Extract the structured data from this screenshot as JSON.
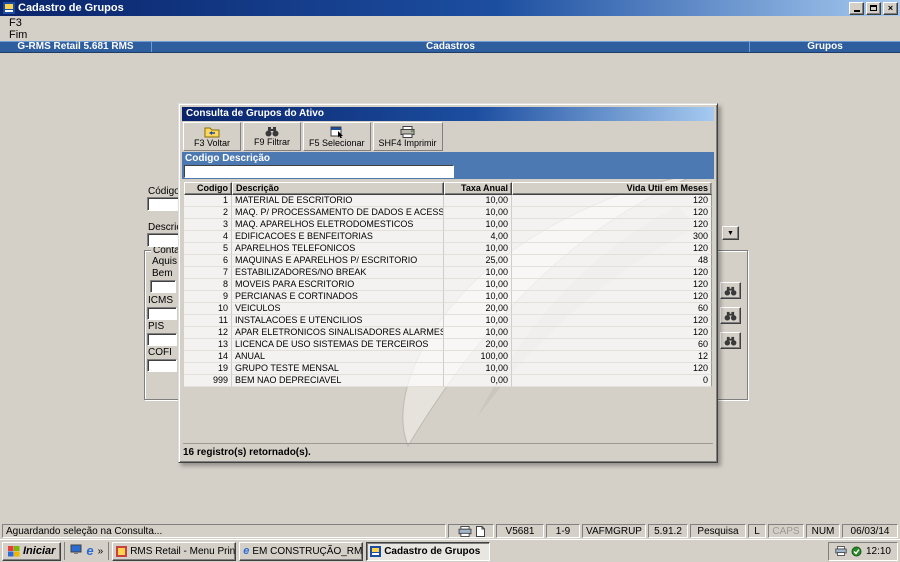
{
  "window": {
    "title": "Cadastro de Grupos",
    "menu_item": "F3",
    "menu_subitem": "Fim",
    "header_left": "G-RMS Retail 5.681 RMS",
    "header_center": "Cadastros",
    "header_right": "Grupos"
  },
  "form": {
    "codigo": "Código",
    "descricao": "Descriç",
    "contab": "Contab",
    "aquis": "Aquis",
    "bem": "Bem",
    "icms": "ICMS",
    "pis": "PIS",
    "cofins": "COFI"
  },
  "dialog": {
    "title": "Consulta de Grupos do Ativo",
    "toolbar_labels": [
      "F3 Voltar",
      "F9 Filtrar",
      "F5 Selecionar",
      "SHF4 Imprimir"
    ],
    "filter_label": "Codigo Descrição",
    "filter_value": "",
    "table": {
      "columns": [
        "Codigo",
        "Descrição",
        "Taxa Anual",
        "Vida Util em Meses"
      ],
      "rows": [
        [
          "1",
          "MATERIAL DE ESCRITORIO",
          "10,00",
          "120"
        ],
        [
          "2",
          "MAQ. P/ PROCESSAMENTO DE DADOS E ACESSOR",
          "10,00",
          "120"
        ],
        [
          "3",
          "MAQ. APARELHOS ELETRODOMESTICOS",
          "10,00",
          "120"
        ],
        [
          "4",
          "EDIFICACOES E BENFEITORIAS",
          "4,00",
          "300"
        ],
        [
          "5",
          "APARELHOS TELEFONICOS",
          "10,00",
          "120"
        ],
        [
          "6",
          "MAQUINAS E APARELHOS P/ ESCRITORIO",
          "25,00",
          "48"
        ],
        [
          "7",
          "ESTABILIZADORES/NO BREAK",
          "10,00",
          "120"
        ],
        [
          "8",
          "MOVEIS PARA ESCRITORIO",
          "10,00",
          "120"
        ],
        [
          "9",
          "PERCIANAS E CORTINADOS",
          "10,00",
          "120"
        ],
        [
          "10",
          "VEICULOS",
          "20,00",
          "60"
        ],
        [
          "11",
          "INSTALACOES E UTENCILIOS",
          "10,00",
          "120"
        ],
        [
          "12",
          "APAR ELETRONICOS SINALISADORES ALARMES",
          "10,00",
          "120"
        ],
        [
          "13",
          "LICENCA DE USO SISTEMAS DE TERCEIROS",
          "20,00",
          "60"
        ],
        [
          "14",
          "ANUAL",
          "100,00",
          "12"
        ],
        [
          "19",
          "GRUPO TESTE MENSAL",
          "10,00",
          "120"
        ],
        [
          "999",
          "BEM NAO DEPRECIAVEL",
          "0,00",
          "0"
        ]
      ]
    },
    "footer": "16 registro(s) retornado(s)."
  },
  "statusbar": {
    "message": "Aguardando seleção na Consulta...",
    "cells": [
      "V5681",
      "1-9",
      "VAFMGRUP",
      "5.91.2",
      "Pesquisa",
      "L",
      "CAPS",
      "NUM",
      "06/03/14"
    ]
  },
  "taskbar": {
    "start_label": "Iniciar",
    "items": [
      "RMS Retail - Menu Princi...",
      "EM CONSTRUÇÃO_RMS ...",
      "Cadastro de Grupos"
    ],
    "time": "12:10"
  },
  "icons": {
    "titlebar": "app-icon",
    "window_controls": [
      "minimize-icon",
      "maximize-icon",
      "close-icon"
    ],
    "dialog_toolbar": [
      "folder-back-icon",
      "binoculars-icon",
      "select-form-icon",
      "printer-icon"
    ],
    "form_lookups": "binoculars-icon",
    "statusbar": [
      "printer-icon",
      "document-icon"
    ],
    "taskbar": [
      "start-windows-icon",
      "desktop-icon",
      "ie-icon",
      "overflow-chevron-icon",
      "rms-app-icon",
      "ie-page-icon",
      "groups-app-icon",
      "tray-print-icon",
      "tray-status-icon"
    ]
  },
  "colors": {
    "titlebar_gradient_start": "#0a246a",
    "titlebar_gradient_end": "#a6caf0",
    "header_blue": "#2f5e9e",
    "filter_band_blue": "#4d79b2",
    "desktop_gray": "#d4d0c8"
  }
}
